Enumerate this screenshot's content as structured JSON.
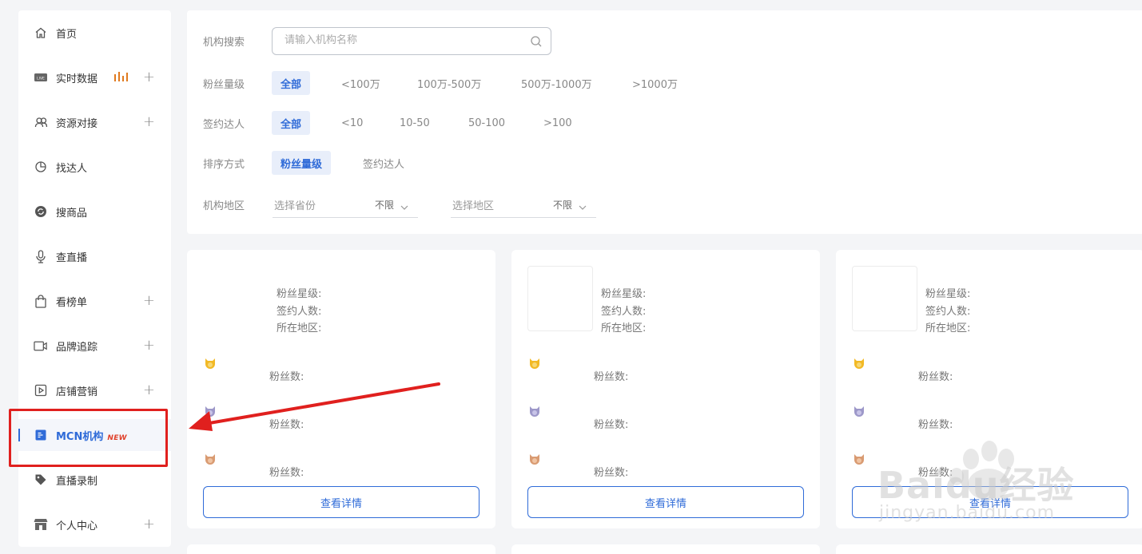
{
  "sidebar": {
    "items": [
      {
        "label": "首页",
        "icon": "home-icon",
        "expandable": false
      },
      {
        "label": "实时数据",
        "icon": "live-icon",
        "expandable": true
      },
      {
        "label": "资源对接",
        "icon": "users-icon",
        "expandable": true
      },
      {
        "label": "找达人",
        "icon": "pie-chart-icon",
        "expandable": false
      },
      {
        "label": "搜商品",
        "icon": "refresh-circle-icon",
        "expandable": false
      },
      {
        "label": "查直播",
        "icon": "microphone-icon",
        "expandable": false
      },
      {
        "label": "看榜单",
        "icon": "shopping-bag-icon",
        "expandable": true
      },
      {
        "label": "品牌追踪",
        "icon": "video-camera-icon",
        "expandable": true
      },
      {
        "label": "店铺营销",
        "icon": "play-square-icon",
        "expandable": true
      },
      {
        "label": "MCN机构",
        "icon": "document-list-icon",
        "expandable": false,
        "active": true,
        "badge": "NEW"
      },
      {
        "label": "直播录制",
        "icon": "tag-icon",
        "expandable": false
      },
      {
        "label": "个人中心",
        "icon": "store-icon",
        "expandable": true
      }
    ],
    "plus_symbol": "+"
  },
  "filters": {
    "search": {
      "label": "机构搜索",
      "placeholder": "请输入机构名称",
      "value": ""
    },
    "fans_level": {
      "label": "粉丝量级",
      "options": [
        "全部",
        "<100万",
        "100万-500万",
        "500万-1000万",
        ">1000万"
      ],
      "selected": "全部"
    },
    "signed": {
      "label": "签约达人",
      "options": [
        "全部",
        "<10",
        "10-50",
        "50-100",
        ">100"
      ],
      "selected": "全部"
    },
    "sort": {
      "label": "排序方式",
      "options": [
        "粉丝量级",
        "签约达人"
      ],
      "selected": "粉丝量级"
    },
    "region": {
      "label": "机构地区",
      "province": {
        "placeholder": "选择省份",
        "value": "不限"
      },
      "area": {
        "placeholder": "选择地区",
        "value": "不限"
      }
    }
  },
  "cards": [
    {
      "fans_level_label": "粉丝星级:",
      "signed_label": "签约人数:",
      "region_label": "所在地区:",
      "fans_count_label": "粉丝数:",
      "button": "查看详情"
    },
    {
      "fans_level_label": "粉丝星级:",
      "signed_label": "签约人数:",
      "region_label": "所在地区:",
      "fans_count_label": "粉丝数:",
      "button": "查看详情"
    },
    {
      "fans_level_label": "粉丝星级:",
      "signed_label": "签约人数:",
      "region_label": "所在地区:",
      "fans_count_label": "粉丝数:",
      "button": "查看详情"
    }
  ],
  "medals": [
    "gold-medal-icon",
    "silver-medal-icon",
    "bronze-medal-icon"
  ],
  "watermark": {
    "brand": "Baidu经验",
    "url": "jingyan.baidu.com"
  },
  "colors": {
    "accent": "#2f6bd8",
    "highlight": "#e0201e",
    "new_badge": "#e0402a",
    "live_bars": "#e07a1f"
  }
}
